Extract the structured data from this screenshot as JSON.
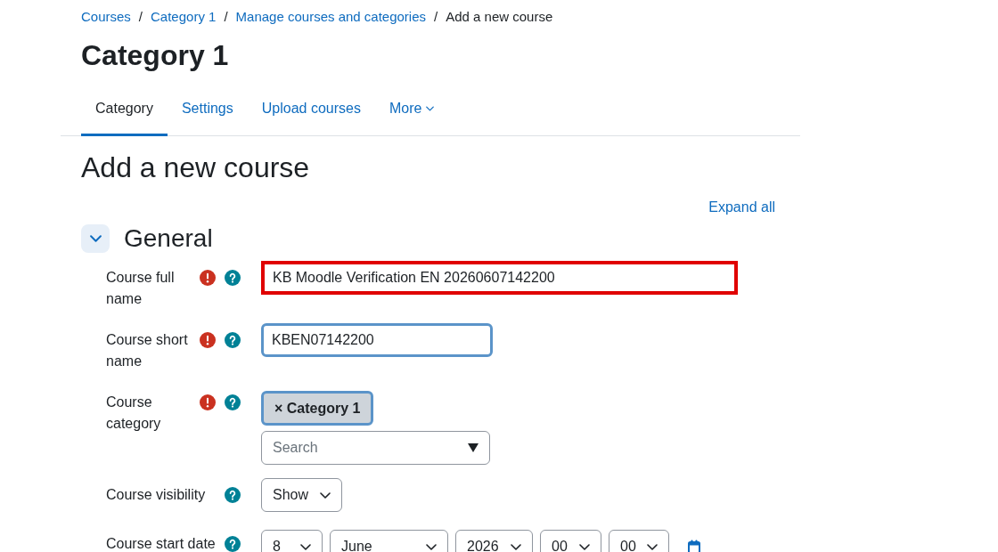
{
  "breadcrumb": {
    "separator": "/",
    "items": [
      {
        "label": "Courses",
        "link": true
      },
      {
        "label": "Category 1",
        "link": true
      },
      {
        "label": "Manage courses and categories",
        "link": true
      },
      {
        "label": "Add a new course",
        "link": false
      }
    ]
  },
  "heading": "Category 1",
  "tabs": [
    {
      "label": "Category",
      "selected": true,
      "dropdown": false
    },
    {
      "label": "Settings",
      "selected": false,
      "dropdown": false
    },
    {
      "label": "Upload courses",
      "selected": false,
      "dropdown": false
    },
    {
      "label": "More",
      "selected": false,
      "dropdown": true
    }
  ],
  "page_title": "Add a new course",
  "expand_all": "Expand all",
  "section": {
    "title": "General",
    "expanded": true,
    "fields": [
      {
        "kind": "text",
        "label": "Course full name",
        "required": true,
        "highlighted": true,
        "focused": false,
        "value": "KB Moodle Verification EN 20260607142200"
      },
      {
        "kind": "text",
        "label": "Course short name",
        "required": true,
        "highlighted": false,
        "focused": true,
        "value": "KBEN07142200"
      },
      {
        "kind": "autocomplete",
        "label": "Course category",
        "required": true,
        "highlighted": false,
        "focused": false,
        "chips": [
          {
            "label": "Category 1",
            "remove": "×",
            "focused": true
          }
        ],
        "placeholder": "Search"
      },
      {
        "kind": "select",
        "label": "Course visibility",
        "required": false,
        "highlighted": false,
        "focused": false,
        "value": "Show"
      },
      {
        "kind": "date",
        "label": "Course start date",
        "required": false,
        "highlighted": false,
        "focused": false,
        "parts": [
          "8",
          "June",
          "2026",
          "00",
          "00"
        ]
      }
    ]
  }
}
